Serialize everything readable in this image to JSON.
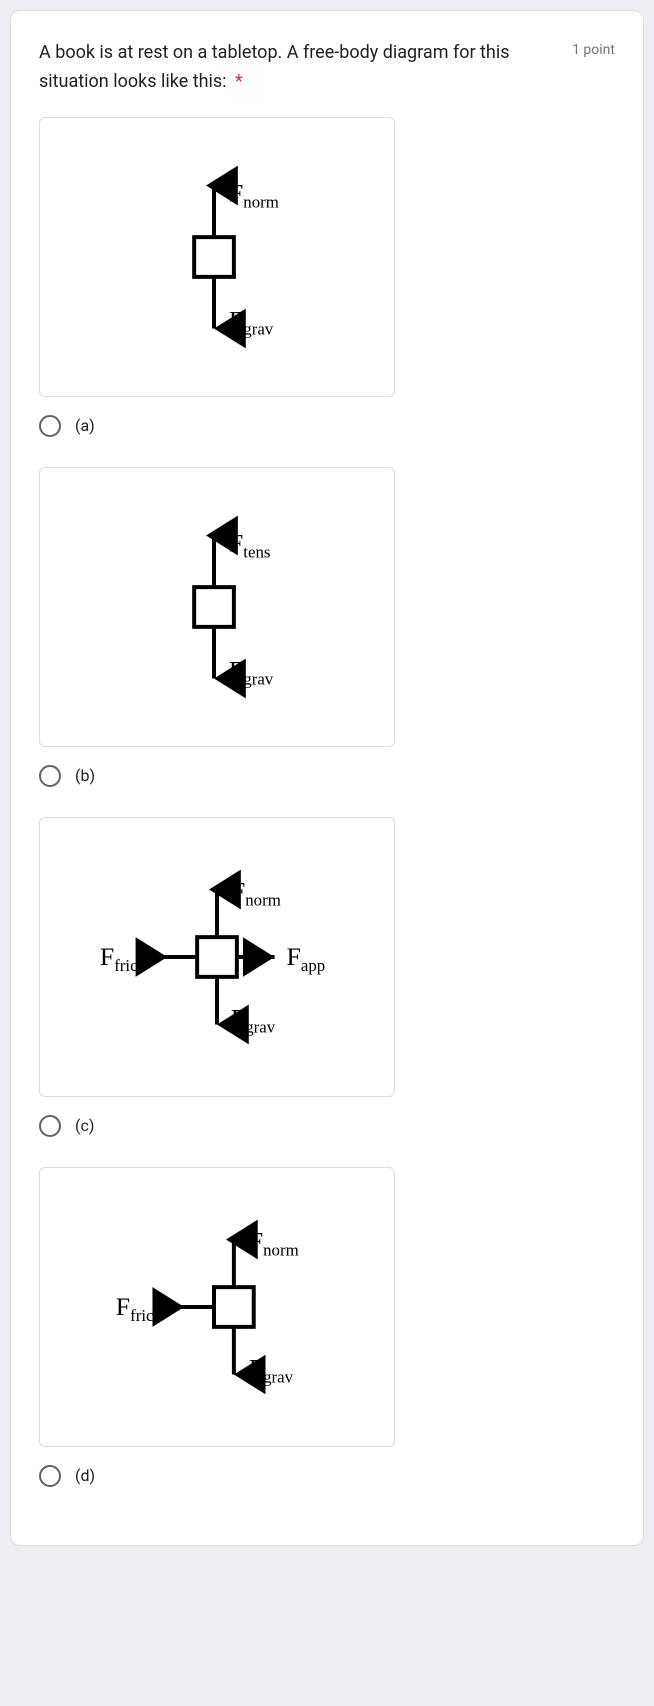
{
  "question": {
    "text": "A book is at rest on a tabletop. A free-body diagram for this situation looks like this:",
    "required_mark": "*",
    "points_label": "1 point"
  },
  "options": {
    "a": {
      "label": "(a)"
    },
    "b": {
      "label": "(b)"
    },
    "c": {
      "label": "(c)"
    },
    "d": {
      "label": "(d)"
    }
  },
  "forces": {
    "F": "F",
    "norm": "norm",
    "grav": "grav",
    "tens": "tens",
    "frict": "frict",
    "app": "app"
  }
}
